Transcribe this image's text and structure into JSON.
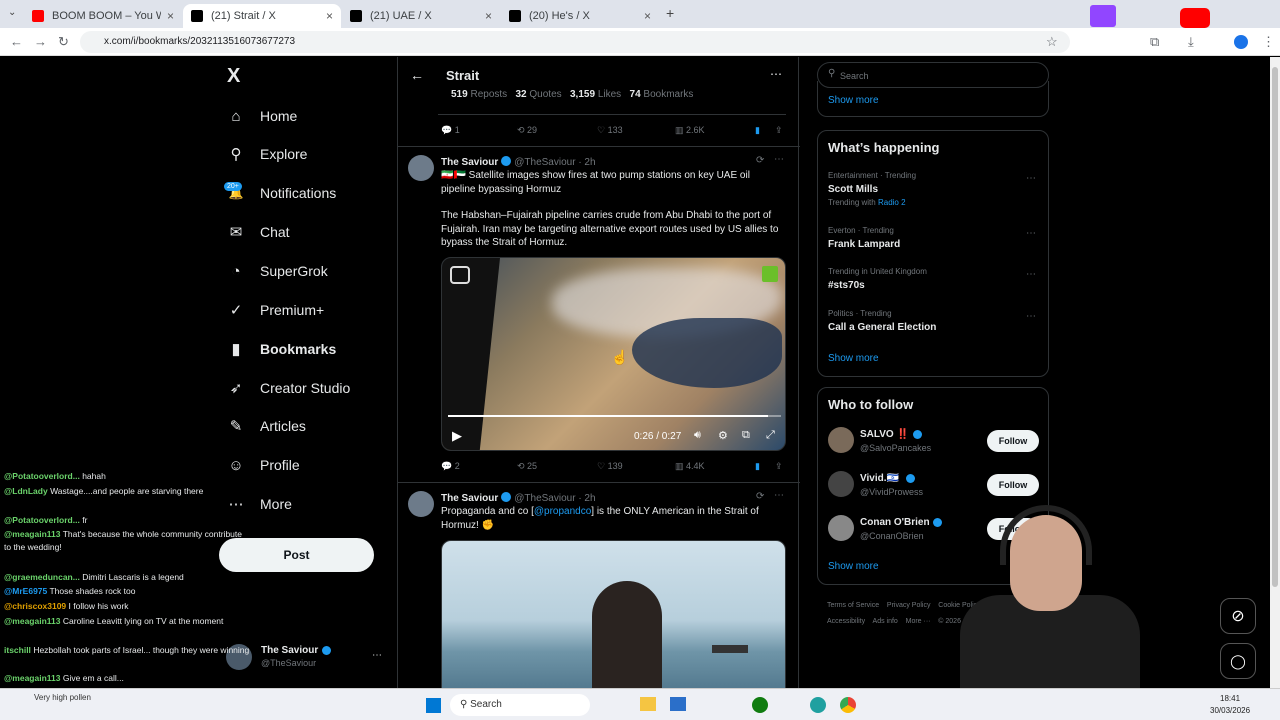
{
  "browser": {
    "tabs": [
      {
        "title": "BOOM BOOM – You Woke The",
        "favicon_color": "#ff0000"
      },
      {
        "title": "(21) Strait / X",
        "favicon_color": "#000000"
      },
      {
        "title": "(21) UAE / X",
        "favicon_color": "#000000"
      },
      {
        "title": "(20) He's / X",
        "favicon_color": "#000000"
      }
    ],
    "new_tab": "+",
    "url": "x.com/i/bookmarks/2032113516073677273"
  },
  "sidebar": {
    "logo": "X",
    "items": [
      {
        "label": "Home",
        "icon": "home-icon",
        "glyph": "⌂"
      },
      {
        "label": "Explore",
        "icon": "search-icon",
        "glyph": "⚲"
      },
      {
        "label": "Notifications",
        "icon": "bell-icon",
        "glyph": "🔔",
        "badge": "20+"
      },
      {
        "label": "Chat",
        "icon": "mail-icon",
        "glyph": "✉"
      },
      {
        "label": "SuperGrok",
        "icon": "grok-icon",
        "glyph": "◔"
      },
      {
        "label": "Premium+",
        "icon": "premium-icon",
        "glyph": "✓"
      },
      {
        "label": "Bookmarks",
        "icon": "bookmark-icon",
        "glyph": "▮"
      },
      {
        "label": "Creator Studio",
        "icon": "rocket-icon",
        "glyph": "➶"
      },
      {
        "label": "Articles",
        "icon": "article-icon",
        "glyph": "✎"
      },
      {
        "label": "Profile",
        "icon": "person-icon",
        "glyph": "☺"
      },
      {
        "label": "More",
        "icon": "more-icon",
        "glyph": "⋯"
      }
    ],
    "post_label": "Post",
    "account": {
      "name": "The Saviour",
      "handle": "@TheSaviour"
    }
  },
  "header": {
    "title": "Strait",
    "back": "←",
    "more": "⋯"
  },
  "prev_tweet": {
    "stats": {
      "reposts": "519",
      "reposts_label": "Reposts",
      "quotes": "32",
      "quotes_label": "Quotes",
      "likes": "3,159",
      "likes_label": "Likes",
      "bookmarks": "74",
      "bookmarks_label": "Bookmarks"
    },
    "actions": {
      "replies": "1",
      "retweets": "29",
      "likes": "133",
      "views": "2.6K"
    }
  },
  "tweets": [
    {
      "name": "The Saviour",
      "handle": "@TheSaviour · 2h",
      "text1": "🇮🇷🇦🇪 Satellite images show fires at two pump stations on key UAE oil pipeline bypassing Hormuz",
      "text2": "The Habshan–Fujairah pipeline carries crude from Abu Dhabi to the port of Fujairah. Iran may be targeting alternative export routes used by US allies to bypass the Strait of Hormuz.",
      "video_time": "0:26 / 0:27",
      "video_progress": 0.96,
      "actions": {
        "replies": "2",
        "retweets": "25",
        "likes": "139",
        "views": "4.4K"
      }
    },
    {
      "name": "The Saviour",
      "handle": "@TheSaviour · 2h",
      "text_a": "Propaganda and co [",
      "text_link": "@propandco",
      "text_b": "] is the ONLY American in the Strait of Hormuz! ✊"
    }
  ],
  "right": {
    "search_placeholder": "Search",
    "show_more_top": "Show more",
    "happening_title": "What’s happening",
    "trends": [
      {
        "context": "Entertainment · Trending",
        "topic": "Scott Mills",
        "extra_prefix": "Trending with",
        "extra_link": "Radio 2"
      },
      {
        "context": "Everton · Trending",
        "topic": "Frank Lampard"
      },
      {
        "context": "Trending in United Kingdom",
        "topic": "#sts70s"
      },
      {
        "context": "Politics · Trending",
        "topic": "Call a General Election"
      }
    ],
    "show_more_trends": "Show more",
    "who_title": "Who to follow",
    "follow": [
      {
        "name": "SALVO ‼️",
        "handle": "@SalvoPancakes",
        "btn": "Follow"
      },
      {
        "name": "Vivid.🇮🇱",
        "handle": "@VividProwess",
        "btn": "Follow"
      },
      {
        "name": "Conan O'Brien",
        "handle": "@ConanOBrien",
        "btn": "Follow"
      }
    ],
    "show_more_follow": "Show more",
    "footer": [
      "Terms of Service",
      "Privacy Policy",
      "Cookie Policy",
      "Accessibility",
      "Ads info",
      "More ···",
      "© 2026"
    ]
  },
  "chat": [
    {
      "user": "@Potatooverlord...",
      "msg": "hahah",
      "color": "#6bd36b"
    },
    {
      "user": "@LdnLady",
      "msg": "Wastage....and people are starving there",
      "color": "#6bd36b"
    },
    {
      "user": "@Potatooverlord...",
      "msg": "fr",
      "color": "#6bd36b"
    },
    {
      "user": "@meagain113",
      "msg": "That's because the whole community contribute to the wedding!",
      "color": "#6bd36b"
    },
    {
      "user": "@graemeduncan...",
      "msg": "Dimitri Lascaris is a legend",
      "color": "#6bd36b"
    },
    {
      "user": "@MrE6975",
      "msg": "Those shades rock too",
      "color": "#1d9bf0"
    },
    {
      "user": "@chriscox3109",
      "msg": "I follow his work",
      "color": "#e0a000"
    },
    {
      "user": "@meagain113",
      "msg": "Caroline Leavitt lying on TV at the moment",
      "color": "#6bd36b"
    },
    {
      "user": "itschill",
      "msg": "Hezbollah took parts of Israel... though they were winning",
      "color": "#6bd36b"
    },
    {
      "user": "@meagain113",
      "msg": "Give em a call...",
      "color": "#6bd36b"
    }
  ],
  "chat_notice": "Very high pollen",
  "taskbar": {
    "search": "Search",
    "time": "18:41",
    "date": "30/03/2026"
  }
}
